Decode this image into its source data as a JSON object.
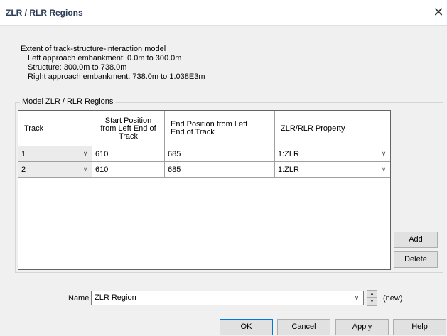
{
  "window": {
    "title": "ZLR / RLR Regions",
    "close_glyph": "✕"
  },
  "extent": {
    "heading": "Extent of track-structure-interaction model",
    "lines": [
      "Left approach embankment: 0.0m to 300.0m",
      "Structure: 300.0m to 738.0m",
      "Right approach embankment: 738.0m to 1.038E3m"
    ]
  },
  "group": {
    "label": "Model ZLR / RLR Regions"
  },
  "grid": {
    "columns": [
      "Track",
      "Start Position from Left End of Track",
      "End Position from Left End of Track",
      "ZLR/RLR Property"
    ],
    "rows": [
      {
        "track": "1",
        "start": "610",
        "end": "685",
        "property": "1:ZLR"
      },
      {
        "track": "2",
        "start": "610",
        "end": "685",
        "property": "1:ZLR"
      }
    ]
  },
  "side_buttons": {
    "add": "Add",
    "delete": "Delete"
  },
  "name": {
    "label": "Name",
    "value": "ZLR Region",
    "status": "(new)"
  },
  "footer": {
    "ok": "OK",
    "cancel": "Cancel",
    "apply": "Apply",
    "help": "Help"
  },
  "icons": {
    "chevron": "chevron-down-icon",
    "spin_up": "spin-up-icon",
    "spin_down": "spin-down-icon",
    "close": "close-icon"
  }
}
